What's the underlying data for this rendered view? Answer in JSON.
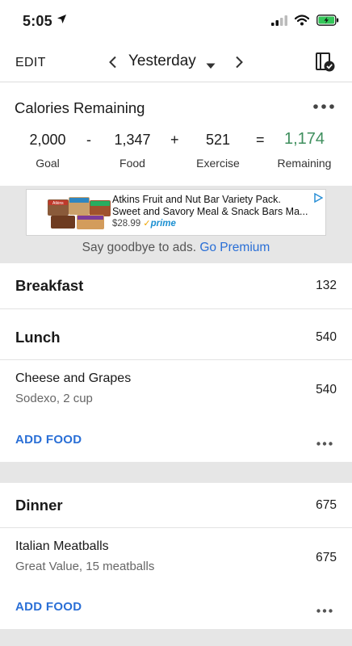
{
  "status_bar": {
    "time": "5:05",
    "icons": [
      "location-arrow-icon",
      "cellular-signal-icon",
      "wifi-icon",
      "battery-charging-icon"
    ],
    "battery_color": "#34c759"
  },
  "header": {
    "edit_label": "EDIT",
    "date_label": "Yesterday",
    "icons": [
      "chevron-left-icon",
      "caret-down-icon",
      "chevron-right-icon",
      "diary-complete-icon"
    ]
  },
  "calories": {
    "title": "Calories Remaining",
    "goal_value": "2,000",
    "goal_label": "Goal",
    "minus": "-",
    "food_value": "1,347",
    "food_label": "Food",
    "plus": "+",
    "exercise_value": "521",
    "exercise_label": "Exercise",
    "equals": "=",
    "remaining_value": "1,174",
    "remaining_label": "Remaining",
    "remaining_color": "#3f8f5e"
  },
  "ad": {
    "title_line1": "Atkins Fruit and Nut Bar Variety Pack.",
    "title_line2": "Sweet and Savory Meal & Snack Bars Ma...",
    "price": "$28.99",
    "prime": "prime",
    "image_brand_text": "Atkins",
    "upsell_text": "Say goodbye to ads.",
    "upsell_link": "Go Premium"
  },
  "meals": {
    "breakfast": {
      "name": "Breakfast",
      "calories": "132"
    },
    "lunch": {
      "name": "Lunch",
      "calories": "540",
      "items": [
        {
          "name": "Cheese and Grapes",
          "detail": "Sodexo, 2 cup",
          "calories": "540"
        }
      ],
      "add_label": "ADD FOOD"
    },
    "dinner": {
      "name": "Dinner",
      "calories": "675",
      "items": [
        {
          "name": "Italian Meatballs",
          "detail": "Great Value, 15 meatballs",
          "calories": "675"
        }
      ],
      "add_label": "ADD FOOD"
    }
  },
  "colors": {
    "accent_blue": "#2a6fd6",
    "remaining_green": "#3f8f5e",
    "separator_gray": "#e6e6e6"
  }
}
